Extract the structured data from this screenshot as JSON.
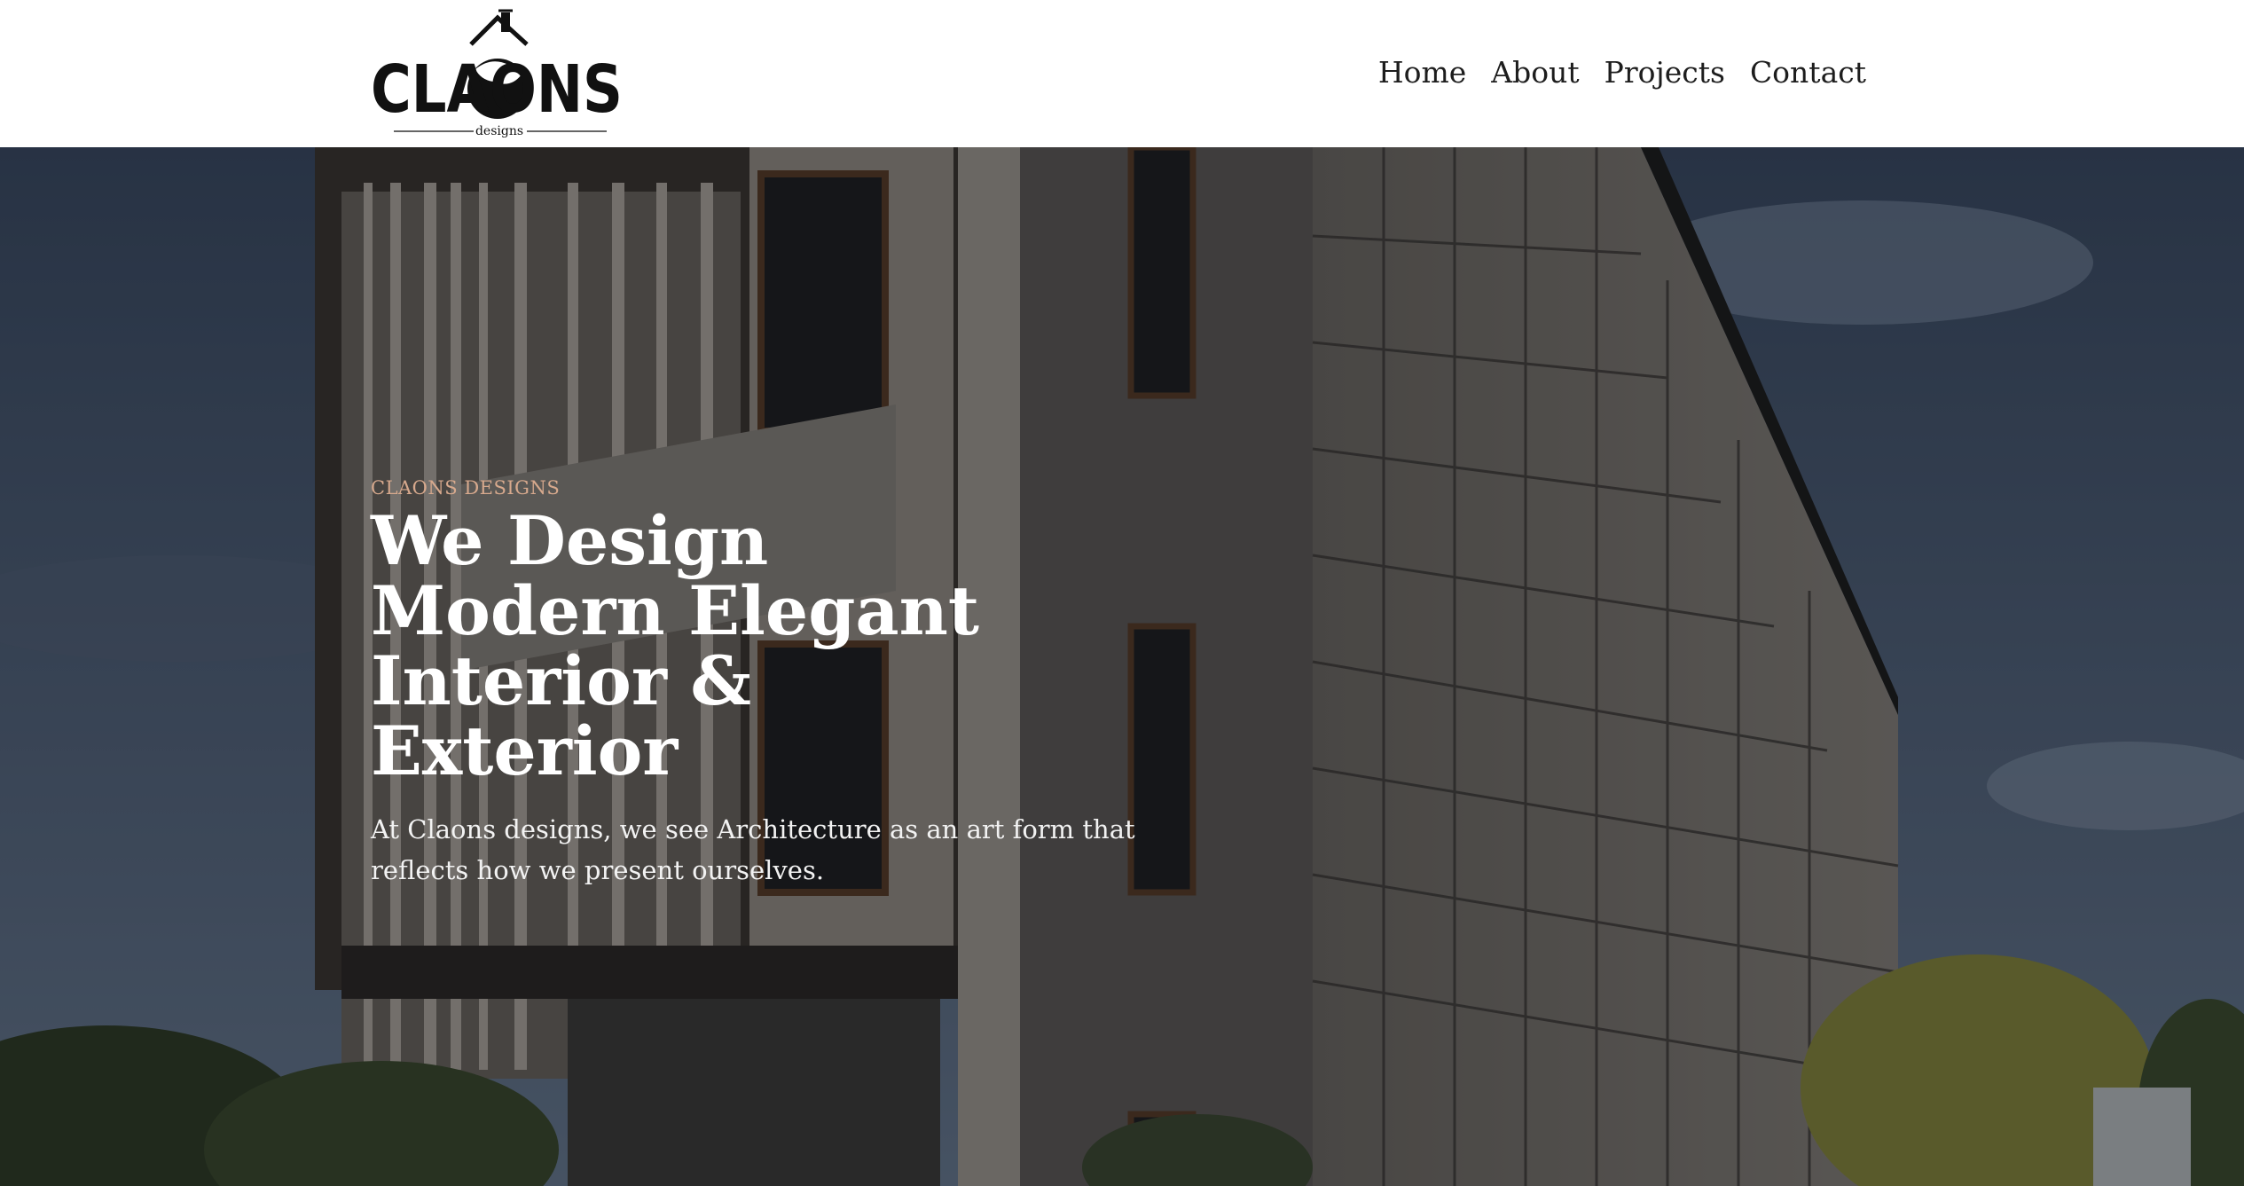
{
  "brand": {
    "name": "CLAONS",
    "tagline": "designs",
    "colors": {
      "nav_text": "#1d1d1d",
      "eyebrow": "#d7a98d",
      "headline": "#ffffff"
    }
  },
  "nav": {
    "items": [
      {
        "label": "Home"
      },
      {
        "label": "About"
      },
      {
        "label": "Projects"
      },
      {
        "label": "Contact"
      }
    ]
  },
  "hero": {
    "eyebrow": "CLAONS DESIGNS",
    "headline": "We Design Modern Elegant Interior & Exterior",
    "subtitle": "At Claons designs, we see Architecture as an art form that reflects how we present ourselves."
  }
}
